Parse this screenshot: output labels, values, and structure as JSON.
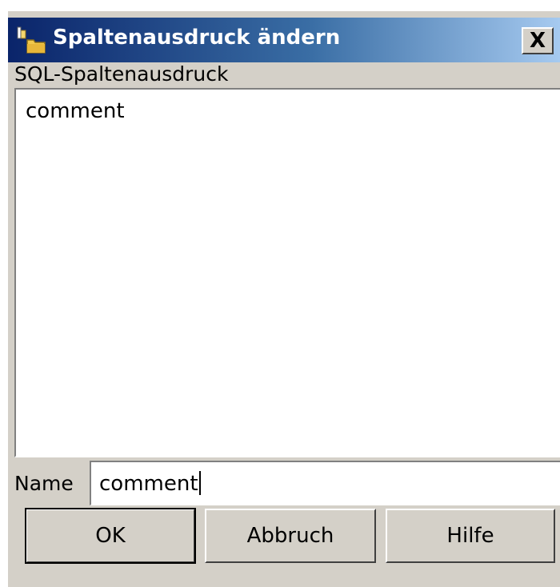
{
  "window": {
    "title": "Spaltenausdruck ändern",
    "icon": "folder-icon",
    "close_label": "X"
  },
  "sql": {
    "label": "SQL-Spaltenausdruck",
    "value": "comment"
  },
  "name": {
    "label": "Name",
    "value": "comment"
  },
  "buttons": {
    "ok": "OK",
    "cancel": "Abbruch",
    "help": "Hilfe"
  },
  "colors": {
    "titlebar_start": "#0a246a",
    "titlebar_end": "#a6caf0",
    "dialog_bg": "#d4d0c8"
  }
}
